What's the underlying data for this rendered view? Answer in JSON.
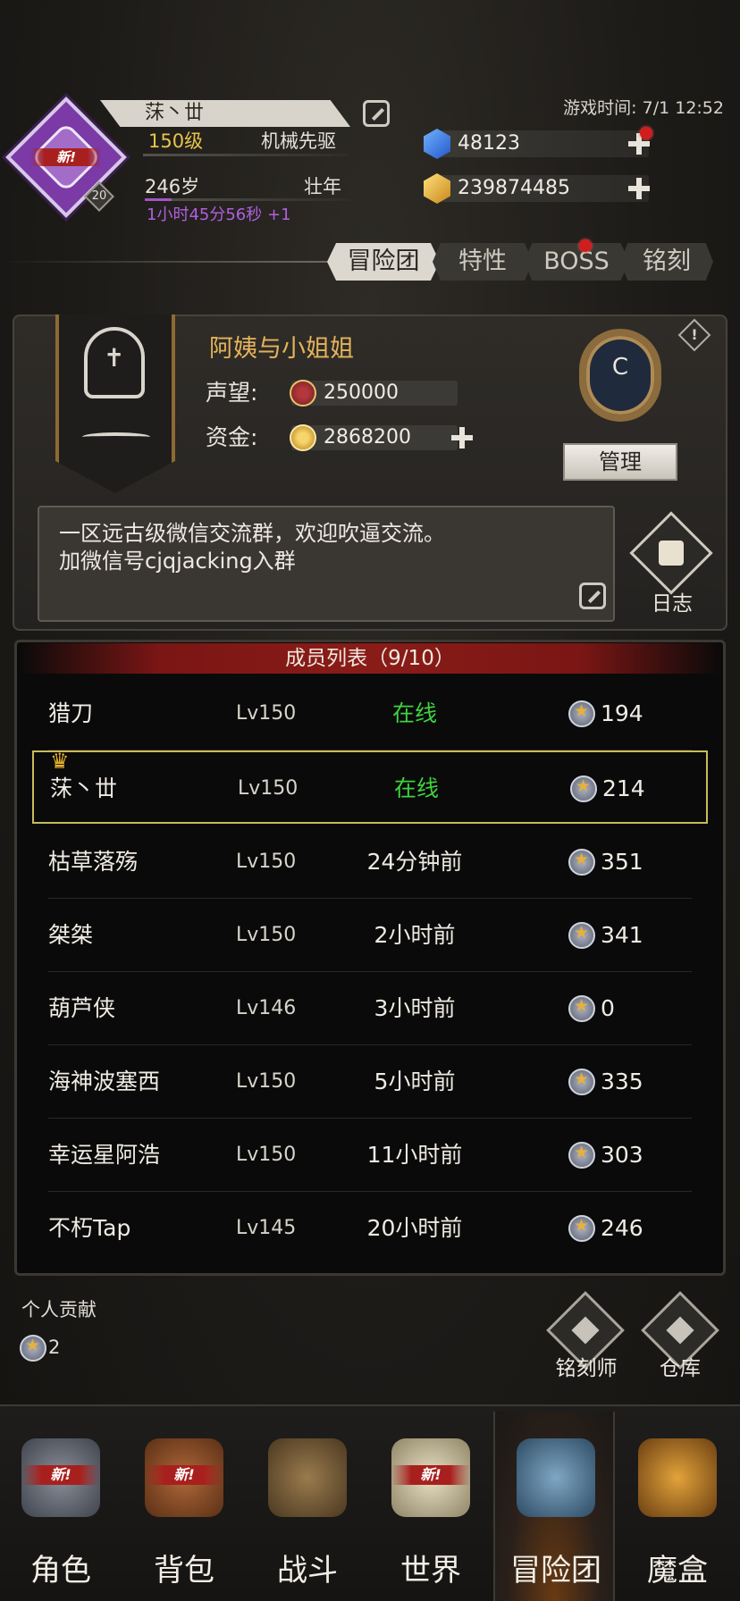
{
  "player": {
    "name": "莯丶丗",
    "level_text": "150级",
    "class": "机械先驱",
    "age": "246岁",
    "age_stage": "壮年",
    "age_timer": "1小时45分56秒 +1",
    "avatar_level": "20",
    "new_badge": "新!"
  },
  "game_time": "游戏时间: 7/1 12:52",
  "currency": {
    "gems": "48123",
    "gold": "239874485"
  },
  "tabs": [
    "冒险团",
    "特性",
    "BOSS",
    "铭刻"
  ],
  "guild": {
    "name": "阿姨与小姐姐",
    "reputation_label": "声望:",
    "reputation": "250000",
    "funds_label": "资金:",
    "funds": "2868200",
    "rank": "C",
    "manage_label": "管理",
    "notice": "一区远古级微信交流群，欢迎吹逼交流。\n加微信号cjqjacking入群",
    "log_label": "日志",
    "info_icon": "!"
  },
  "members": {
    "header": "成员列表（9/10）",
    "rows": [
      {
        "name": "猎刀",
        "level": "Lv150",
        "status": "在线",
        "contribution": "194"
      },
      {
        "name": "莯丶丗",
        "level": "Lv150",
        "status": "在线",
        "contribution": "214"
      },
      {
        "name": "枯草落殇",
        "level": "Lv150",
        "status": "24分钟前",
        "contribution": "351"
      },
      {
        "name": "桀桀",
        "level": "Lv150",
        "status": "2小时前",
        "contribution": "341"
      },
      {
        "name": "葫芦侠",
        "level": "Lv146",
        "status": "3小时前",
        "contribution": "0"
      },
      {
        "name": "海神波塞西",
        "level": "Lv150",
        "status": "5小时前",
        "contribution": "335"
      },
      {
        "name": "幸运星阿浩",
        "level": "Lv150",
        "status": "11小时前",
        "contribution": "303"
      },
      {
        "name": "不朽Tap",
        "level": "Lv145",
        "status": "20小时前",
        "contribution": "246"
      }
    ]
  },
  "personal": {
    "label": "个人贡献",
    "value": "2"
  },
  "actions": {
    "engraver": "铭刻师",
    "warehouse": "仓库"
  },
  "nav": {
    "items": [
      "角色",
      "背包",
      "战斗",
      "世界",
      "冒险团",
      "魔盒"
    ],
    "new_badge": "新!"
  },
  "colors": {
    "online": "#3fd23f",
    "guild_name": "#e4b35a",
    "accent_red": "#8a1c18",
    "self_border": "#c8bc5a"
  }
}
